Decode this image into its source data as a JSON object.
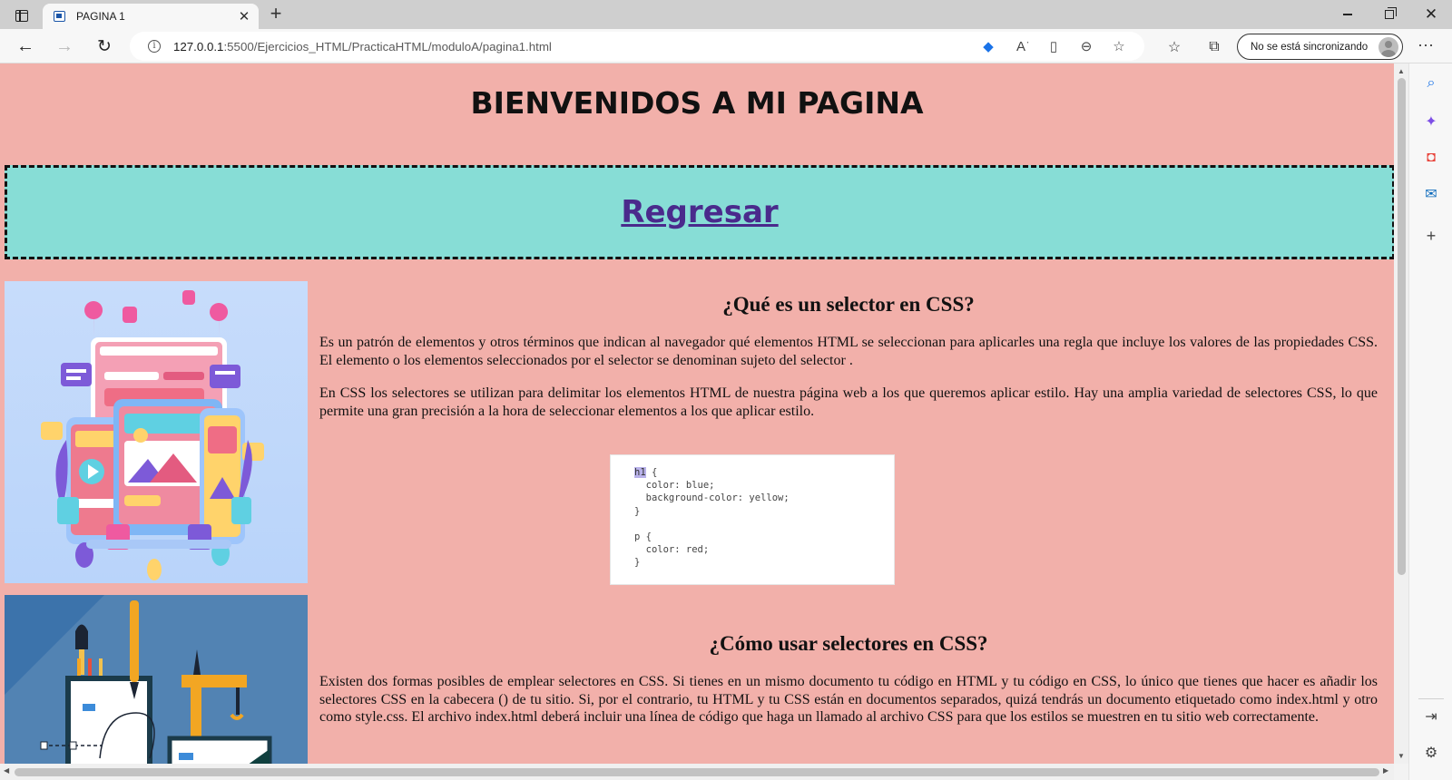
{
  "browser": {
    "tab_title": "PAGINA 1",
    "new_tab_symbol": "+",
    "close_tab_symbol": "✕",
    "url_host": "127.0.0.1",
    "url_path": ":5500/Ejercicios_HTML/PracticaHTML/moduloA/pagina1.html",
    "sync_label": "No se está sincronizando",
    "icons": {
      "back": "back-arrow-icon",
      "forward": "forward-arrow-icon",
      "reload": "reload-icon",
      "info": "site-info-icon",
      "shopping": "shopping-tag-icon",
      "read_aloud": "read-aloud-icon",
      "immersive": "immersive-reader-icon",
      "zoom": "zoom-out-icon",
      "favorite_add": "add-favorite-icon",
      "favorites": "favorites-icon",
      "collections": "collections-icon",
      "more": "more-icon"
    },
    "accent_color": "#1a73e8"
  },
  "page": {
    "title": "BIENVENIDOS A MI PAGINA",
    "back_link": "Regresar",
    "background_color": "#f2b0aa",
    "nav_box_color": "#87ddd6",
    "link_color": "#4a2a8c",
    "sections": [
      {
        "heading": "¿Qué es un selector en CSS?",
        "paragraphs": [
          "Es un patrón de elementos y otros términos que indican al navegador qué elementos HTML se seleccionan para aplicarles una regla que incluye los valores de las propiedades CSS. El elemento o los elementos seleccionados por el selector se denominan sujeto del selector .",
          "En CSS los selectores se utilizan para delimitar los elementos HTML de nuestra página web a los que queremos aplicar estilo. Hay una amplia variedad de selectores CSS, lo que permite una gran precisión a la hora de seleccionar elementos a los que aplicar estilo."
        ]
      },
      {
        "heading": "¿Cómo usar selectores en CSS?",
        "paragraphs": [
          "Existen dos formas posibles de emplear selectores en CSS. Si tienes en un mismo documento tu código en HTML y tu código en CSS, lo único que tienes que hacer es añadir los selectores CSS en la cabecera () de tu sitio. Si, por el contrario, tu HTML y tu CSS están en documentos separados, quizá tendrás un documento etiquetado como index.html y otro como style.css. El archivo index.html deberá incluir una línea de código que haga un llamado al archivo CSS para que los estilos se muestren en tu sitio web correctamente."
        ]
      }
    ],
    "code_example": {
      "selector_highlight": "h1",
      "line1_rest": " {",
      "line2": "  color: blue;",
      "line3": "  background-color: yellow;",
      "line4": "}",
      "line5": "",
      "line6": "p {",
      "line7": "  color: red;",
      "line8": "}"
    }
  }
}
